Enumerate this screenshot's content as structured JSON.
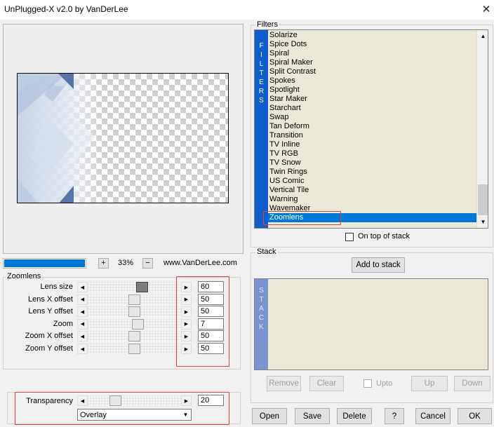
{
  "window": {
    "title": "UnPlugged-X v2.0 by VanDerLee",
    "close_glyph": "✕"
  },
  "preview": {
    "zoom_percent": "33%",
    "zoom_in_label": "+",
    "zoom_out_label": "−",
    "website": "www.VanDerLee.com",
    "progress_fraction": 1.0
  },
  "zoomlens": {
    "group_label": "Zoomlens",
    "params": [
      {
        "label": "Lens size",
        "value": "60",
        "level": 0.6
      },
      {
        "label": "Lens X offset",
        "value": "50",
        "level": 0.5
      },
      {
        "label": "Lens Y offset",
        "value": "50",
        "level": 0.5
      },
      {
        "label": "Zoom",
        "value": "7",
        "level": 0.55
      },
      {
        "label": "Zoom X offset",
        "value": "50",
        "level": 0.5
      },
      {
        "label": "Zoom Y offset",
        "value": "50",
        "level": 0.5
      }
    ]
  },
  "transparency": {
    "label": "Transparency",
    "value": "20",
    "level": 0.2,
    "blend_mode": "Overlay"
  },
  "filters": {
    "group_label": "Filters",
    "strip_text": "FILTERS",
    "items": [
      "Solarize",
      "Spice Dots",
      "Spiral",
      "Spiral Maker",
      "Split Contrast",
      "Spokes",
      "Spotlight",
      "Star Maker",
      "Starchart",
      "Swap",
      "Tan Deform",
      "Transition",
      "TV Inline",
      "TV RGB",
      "TV Snow",
      "Twin Rings",
      "US Comic",
      "Vertical Tile",
      "Warning",
      "Wavemaker",
      "Zoomlens"
    ],
    "selected": "Zoomlens",
    "on_top_label": "On top of stack"
  },
  "stack": {
    "group_label": "Stack",
    "strip_text": "STACK",
    "add_label": "Add to stack",
    "remove_label": "Remove",
    "clear_label": "Clear",
    "upto_label": "Upto",
    "up_label": "Up",
    "down_label": "Down"
  },
  "buttons": {
    "open": "Open",
    "save": "Save",
    "delete": "Delete",
    "help": "?",
    "cancel": "Cancel",
    "ok": "OK"
  },
  "colors": {
    "accent": "#0078d7",
    "filter_strip": "#0f5ccf",
    "stack_strip": "#7b93cf",
    "highlight": "#e2423a",
    "list_bg": "#ebe8d8"
  }
}
